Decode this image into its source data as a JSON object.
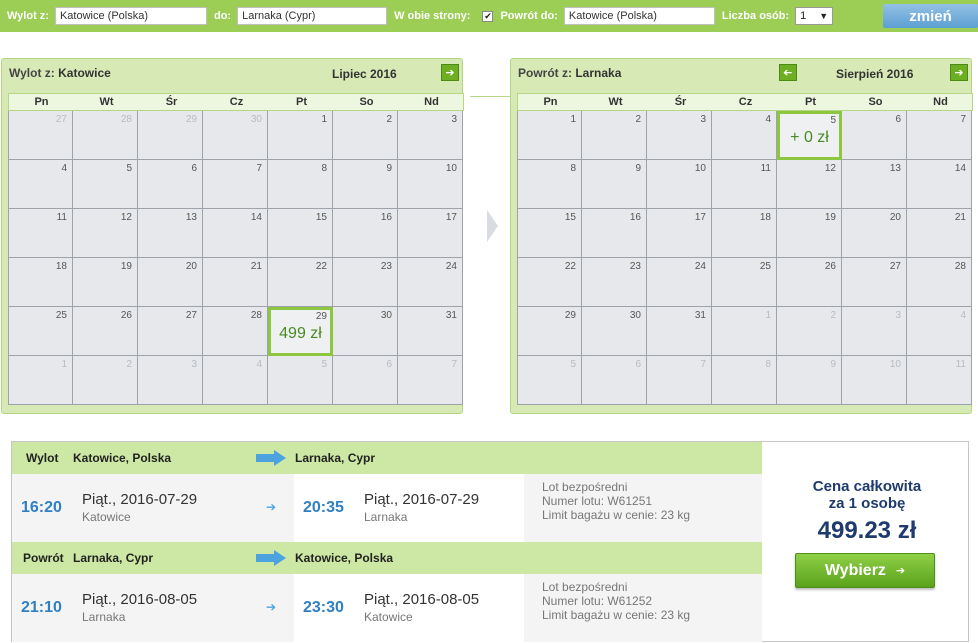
{
  "search": {
    "from_label": "Wylot z:",
    "from_value": "Katowice (Polska)",
    "to_label": "do:",
    "to_value": "Larnaka (Cypr)",
    "roundtrip_label": "W obie strony:",
    "roundtrip_checked": true,
    "return_label": "Powrót do:",
    "return_value": "Katowice (Polska)",
    "persons_label": "Liczba osób:",
    "persons_value": "1",
    "change_button": "zmień"
  },
  "calendars": [
    {
      "label": "Wylot z:",
      "city": "Katowice",
      "month": "Lipiec 2016",
      "weekdays": [
        "Pn",
        "Wt",
        "Śr",
        "Cz",
        "Pt",
        "So",
        "Nd"
      ],
      "days": [
        {
          "n": "27",
          "o": true
        },
        {
          "n": "28",
          "o": true
        },
        {
          "n": "29",
          "o": true
        },
        {
          "n": "30",
          "o": true
        },
        {
          "n": "1"
        },
        {
          "n": "2"
        },
        {
          "n": "3"
        },
        {
          "n": "4"
        },
        {
          "n": "5"
        },
        {
          "n": "6"
        },
        {
          "n": "7"
        },
        {
          "n": "8"
        },
        {
          "n": "9"
        },
        {
          "n": "10"
        },
        {
          "n": "11"
        },
        {
          "n": "12"
        },
        {
          "n": "13"
        },
        {
          "n": "14"
        },
        {
          "n": "15"
        },
        {
          "n": "16"
        },
        {
          "n": "17"
        },
        {
          "n": "18"
        },
        {
          "n": "19"
        },
        {
          "n": "20"
        },
        {
          "n": "21"
        },
        {
          "n": "22"
        },
        {
          "n": "23"
        },
        {
          "n": "24"
        },
        {
          "n": "25"
        },
        {
          "n": "26"
        },
        {
          "n": "27"
        },
        {
          "n": "28"
        },
        {
          "n": "29",
          "sel": true,
          "price": "499 zł"
        },
        {
          "n": "30"
        },
        {
          "n": "31"
        },
        {
          "n": "1",
          "o": true
        },
        {
          "n": "2",
          "o": true
        },
        {
          "n": "3",
          "o": true
        },
        {
          "n": "4",
          "o": true
        },
        {
          "n": "5",
          "o": true
        },
        {
          "n": "6",
          "o": true
        },
        {
          "n": "7",
          "o": true
        }
      ]
    },
    {
      "label": "Powrót z:",
      "city": "Larnaka",
      "month": "Sierpień 2016",
      "weekdays": [
        "Pn",
        "Wt",
        "Śr",
        "Cz",
        "Pt",
        "So",
        "Nd"
      ],
      "days": [
        {
          "n": "1"
        },
        {
          "n": "2"
        },
        {
          "n": "3"
        },
        {
          "n": "4"
        },
        {
          "n": "5",
          "sel": true,
          "price": "+ 0 zł"
        },
        {
          "n": "6"
        },
        {
          "n": "7"
        },
        {
          "n": "8"
        },
        {
          "n": "9"
        },
        {
          "n": "10"
        },
        {
          "n": "11"
        },
        {
          "n": "12"
        },
        {
          "n": "13"
        },
        {
          "n": "14"
        },
        {
          "n": "15"
        },
        {
          "n": "16"
        },
        {
          "n": "17"
        },
        {
          "n": "18"
        },
        {
          "n": "19"
        },
        {
          "n": "20"
        },
        {
          "n": "21"
        },
        {
          "n": "22"
        },
        {
          "n": "23"
        },
        {
          "n": "24"
        },
        {
          "n": "25"
        },
        {
          "n": "26"
        },
        {
          "n": "27"
        },
        {
          "n": "28"
        },
        {
          "n": "29"
        },
        {
          "n": "30"
        },
        {
          "n": "31"
        },
        {
          "n": "1",
          "o": true
        },
        {
          "n": "2",
          "o": true
        },
        {
          "n": "3",
          "o": true
        },
        {
          "n": "4",
          "o": true
        },
        {
          "n": "5",
          "o": true
        },
        {
          "n": "6",
          "o": true
        },
        {
          "n": "7",
          "o": true
        },
        {
          "n": "8",
          "o": true
        },
        {
          "n": "9",
          "o": true
        },
        {
          "n": "10",
          "o": true
        },
        {
          "n": "11",
          "o": true
        }
      ]
    }
  ],
  "legs": [
    {
      "label": "Wylot",
      "from": "Katowice, Polska",
      "to": "Larnaka, Cypr",
      "dep_time": "16:20",
      "dep_weekday": "Piąt.",
      "dep_date": "2016-07-29",
      "dep_city": "Katowice",
      "arr_time": "20:35",
      "arr_weekday": "Piąt.",
      "arr_date": "2016-07-29",
      "arr_city": "Larnaka",
      "type": "Lot bezpośredni",
      "flight_no": "Numer lotu: W61251",
      "baggage": "Limit bagażu w cenie: 23 kg"
    },
    {
      "label": "Powrót",
      "from": "Larnaka, Cypr",
      "to": "Katowice, Polska",
      "dep_time": "21:10",
      "dep_weekday": "Piąt.",
      "dep_date": "2016-08-05",
      "dep_city": "Larnaka",
      "arr_time": "23:30",
      "arr_weekday": "Piąt.",
      "arr_date": "2016-08-05",
      "arr_city": "Katowice",
      "type": "Lot bezpośredni",
      "flight_no": "Numer lotu: W61252",
      "baggage": "Limit bagażu w cenie: 23 kg"
    }
  ],
  "total": {
    "title_line1": "Cena całkowita",
    "title_line2": "za 1 osobę",
    "price": "499.23 zł",
    "button": "Wybierz"
  },
  "colors": {
    "accent_green": "#9ccd54",
    "price_blue": "#1f3a6e",
    "time_blue": "#2f7fc1"
  }
}
